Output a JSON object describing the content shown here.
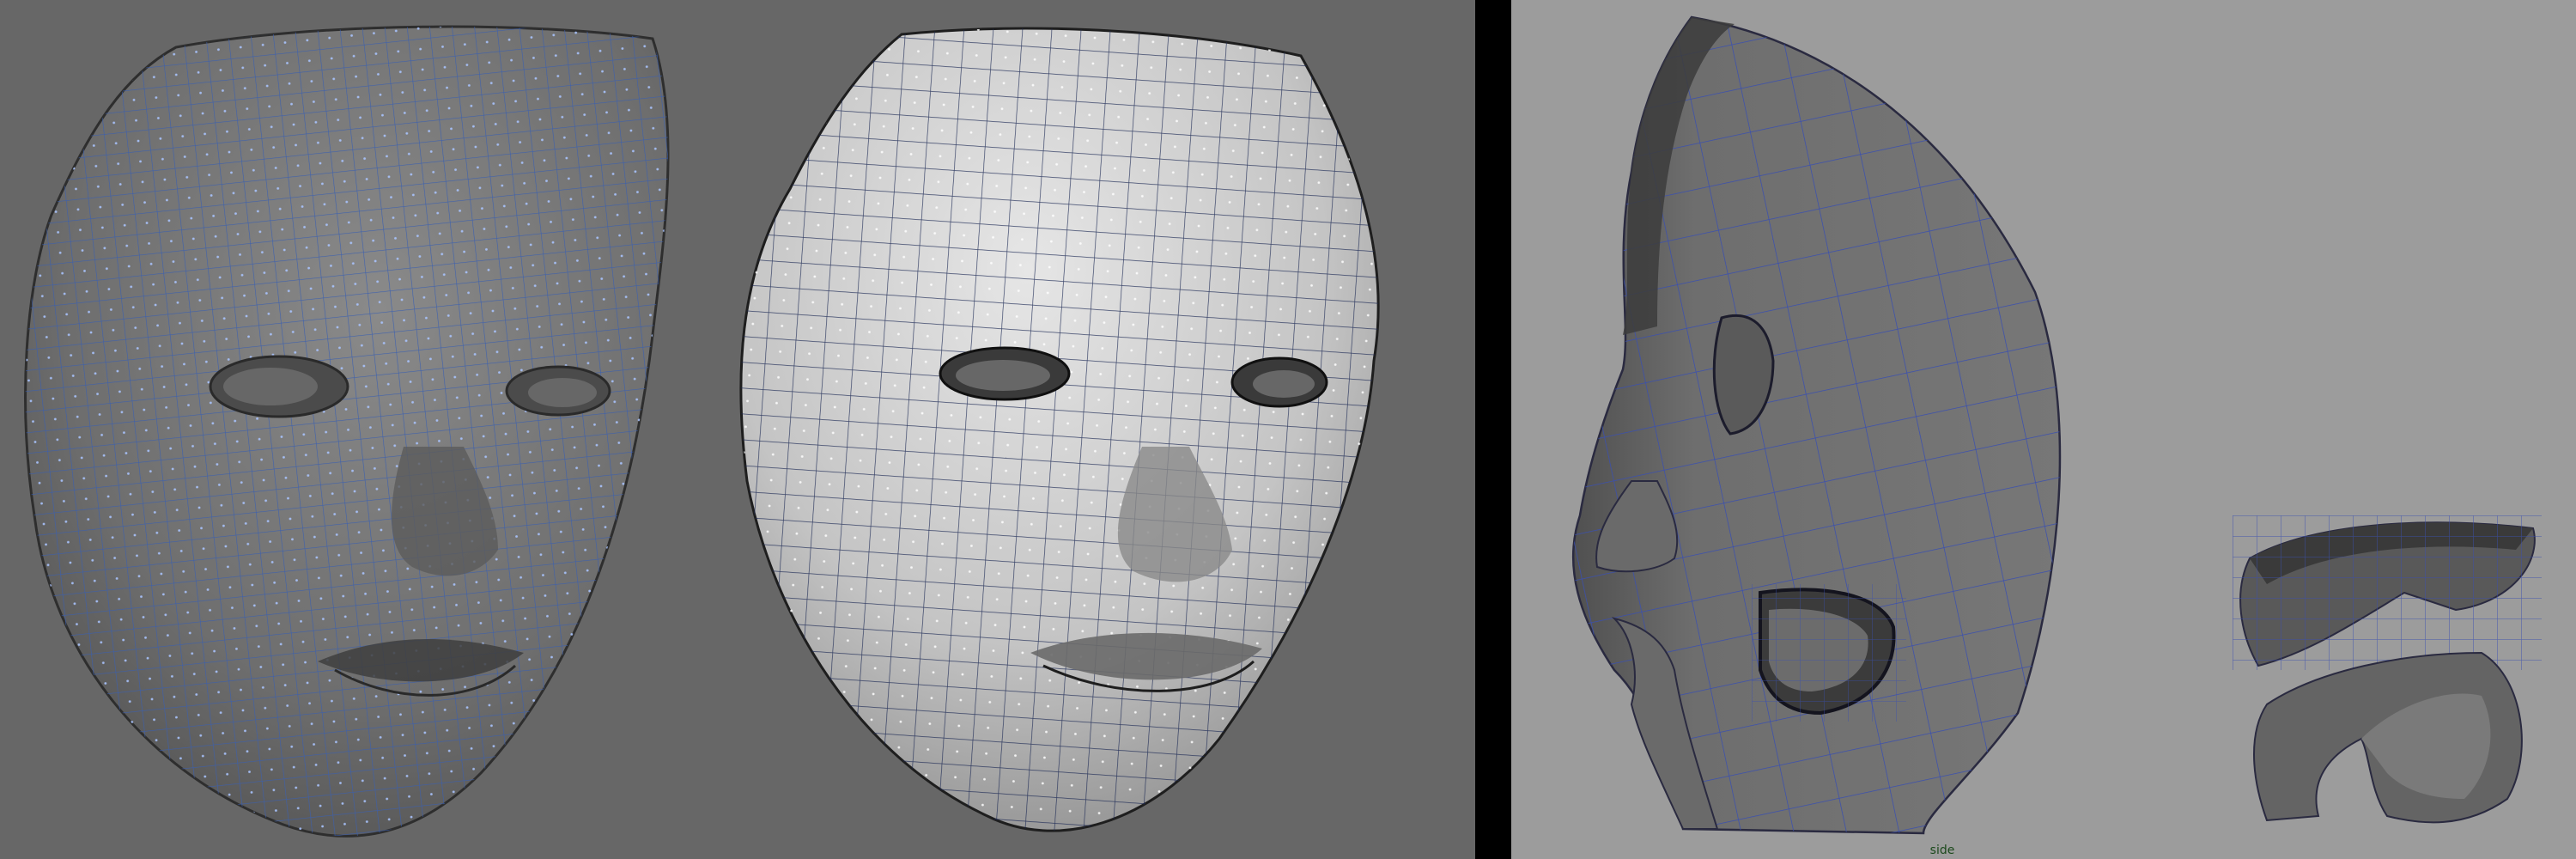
{
  "window": {
    "layout": "two-pane-3d-viewport"
  },
  "viewports": {
    "left": {
      "background": "#676767",
      "objects": [
        {
          "name": "sculpted-face-mesh",
          "shading": "smooth-wireframe"
        },
        {
          "name": "retopology-face-mesh",
          "shading": "flat-wireframe"
        }
      ]
    },
    "right": {
      "background": "#9c9c9c",
      "camera_label": "side",
      "objects": [
        {
          "name": "half-head-mesh",
          "shading": "flat-wireframe"
        },
        {
          "name": "ear-part-upper"
        },
        {
          "name": "ear-part-lower"
        }
      ]
    }
  },
  "colors": {
    "wireframe": "#3a5fb0",
    "vertex": "#a9c4ff",
    "divider": "#000000",
    "mesh_dark": "#4c4c4c",
    "mesh_light": "#d9d9d9"
  }
}
